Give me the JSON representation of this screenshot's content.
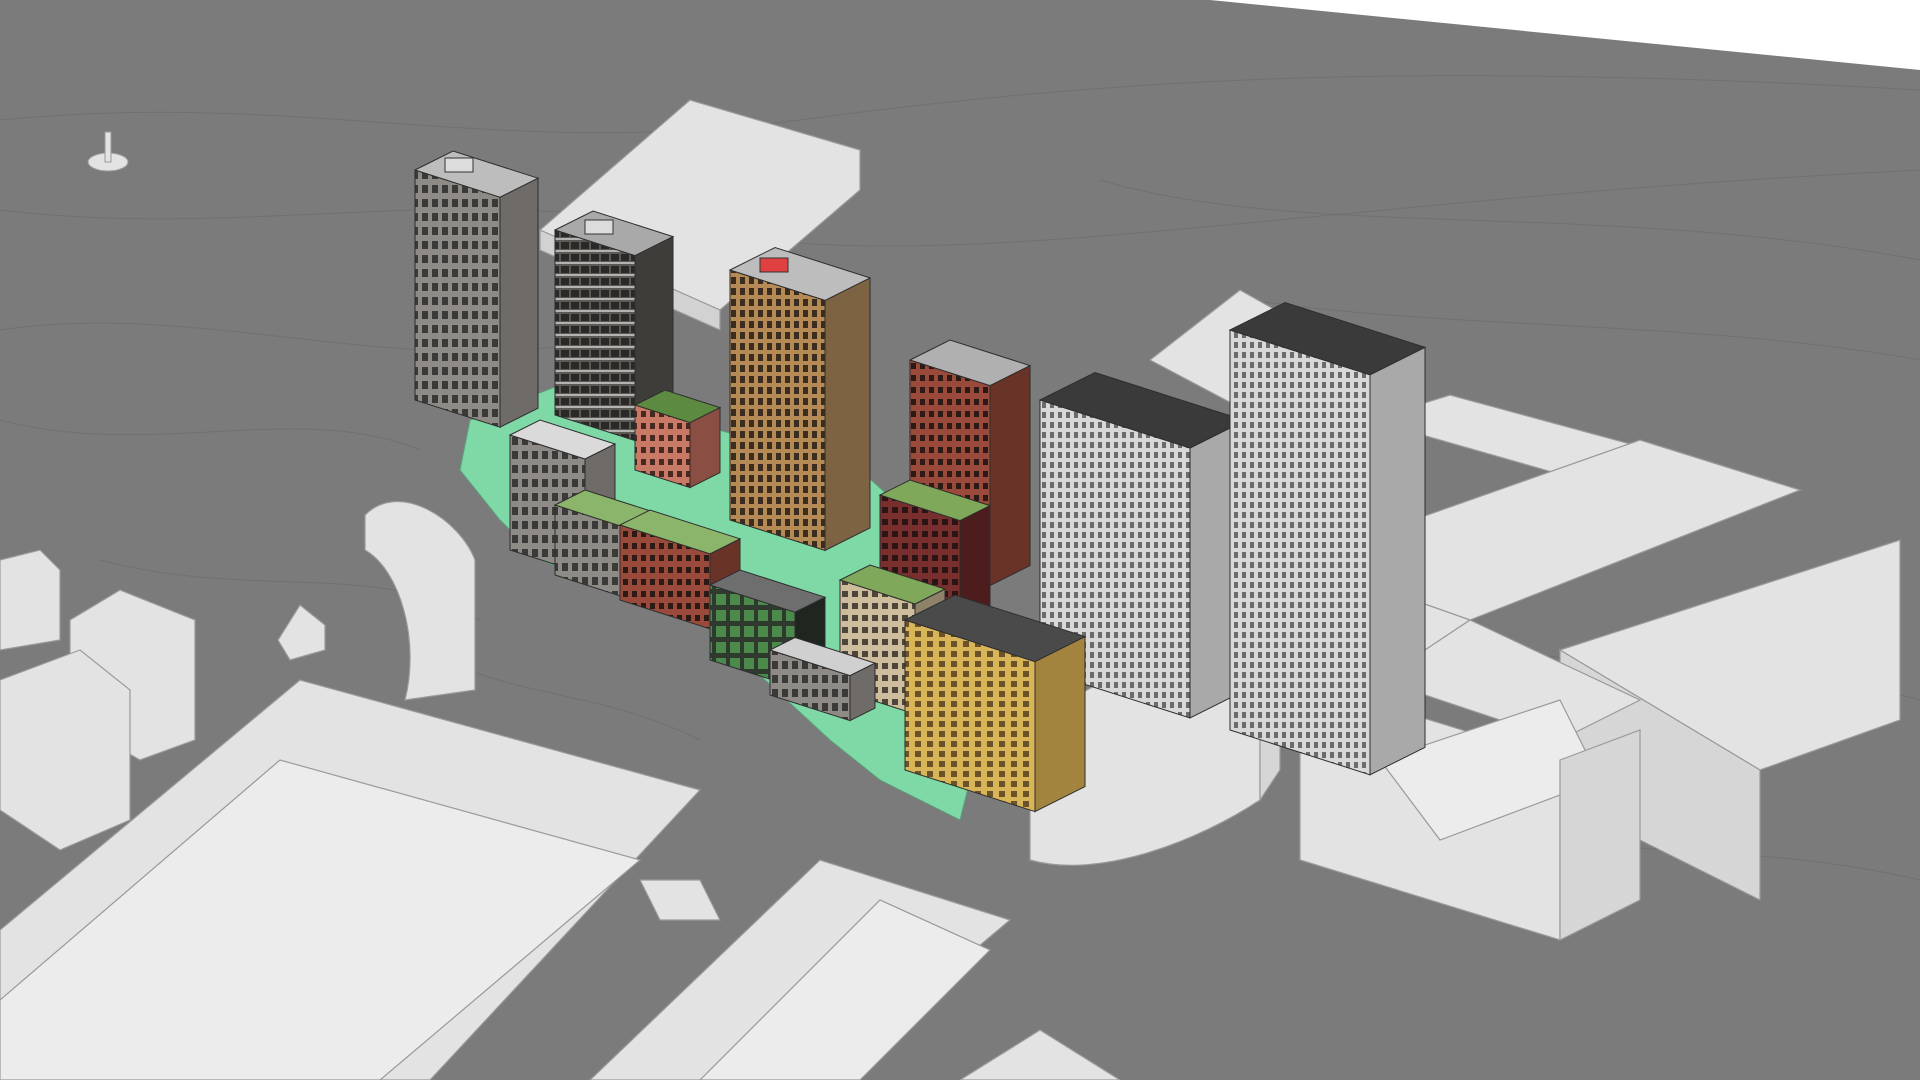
{
  "scene": {
    "view": "3d-isometric-massing-model",
    "colors": {
      "terrain": "#7b7b7b",
      "contour": "#6a6a6a",
      "sky": "#ffffff",
      "context_massing": "#e3e3e3",
      "context_edge": "#9a9a9a",
      "landscape": "#7fd9a6",
      "grey_facade": "#8e8a86",
      "dark_facade": "#5d5a56",
      "brick_red": "#9a4a3a",
      "terracotta": "#c97a66",
      "timber": "#b58a55",
      "green_roof": "#7fa85a",
      "white_facade": "#d8d8d8"
    },
    "buildings": [
      {
        "name": "tower-nw-grey"
      },
      {
        "name": "tower-dark-balconies"
      },
      {
        "name": "tower-timber"
      },
      {
        "name": "tower-brick-centre"
      },
      {
        "name": "block-terracotta"
      },
      {
        "name": "block-grey-low"
      },
      {
        "name": "block-beige-green-roof"
      },
      {
        "name": "block-brick-red-south"
      },
      {
        "name": "block-dark-frame"
      },
      {
        "name": "block-brick-maroon"
      },
      {
        "name": "block-small-grey"
      },
      {
        "name": "block-beige-mid"
      },
      {
        "name": "block-curved-timber"
      },
      {
        "name": "tower-white-stepped-left"
      },
      {
        "name": "tower-white-stepped-right"
      }
    ]
  }
}
